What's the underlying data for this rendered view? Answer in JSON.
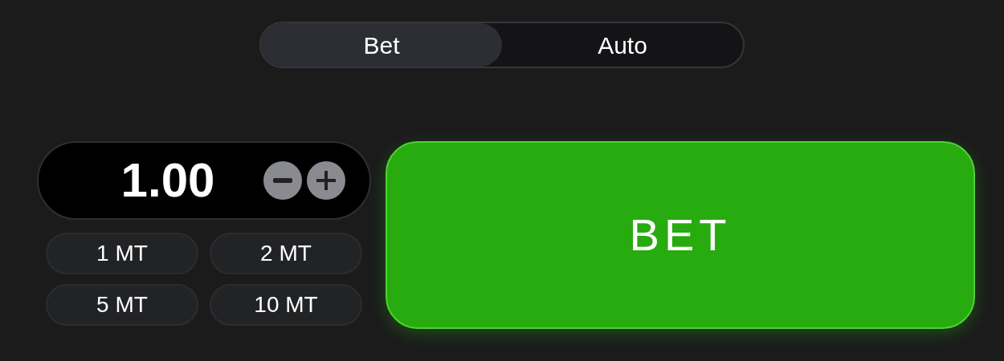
{
  "tabs": [
    {
      "label": "Bet",
      "selected": true
    },
    {
      "label": "Auto",
      "selected": false
    }
  ],
  "amount": {
    "value": "1.00"
  },
  "quick_amounts": [
    "1 MT",
    "2 MT",
    "5 MT",
    "10 MT"
  ],
  "bet_button": {
    "label": "BET"
  }
}
